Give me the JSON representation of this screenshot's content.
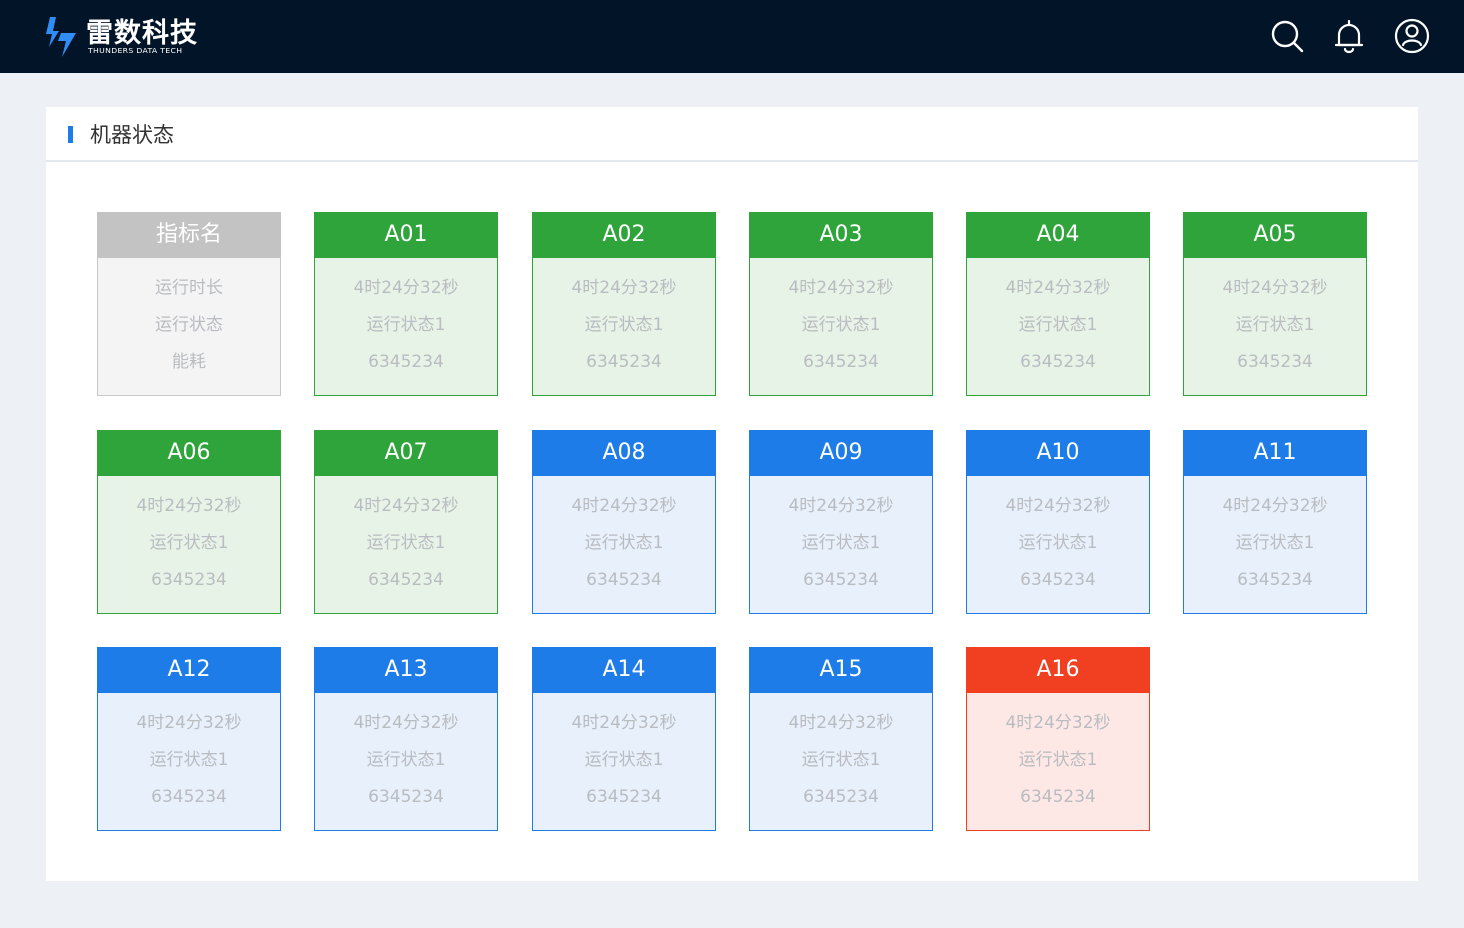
{
  "header": {
    "brand_cn": "雷数科技",
    "brand_en": "THUNDERS DATA TECH",
    "icons": [
      "search-icon",
      "bell-icon",
      "user-icon"
    ]
  },
  "panel": {
    "title": "机器状态"
  },
  "colors": {
    "accent": "#1e7ce8",
    "running": "#2ea43b",
    "standby": "#1e7ce8",
    "fault": "#f13f22",
    "legend": "#c3c3c3"
  },
  "legend_card": {
    "title": "指标名",
    "lines": [
      "运行时长",
      "运行状态",
      "能耗"
    ]
  },
  "machines": [
    {
      "id": "A01",
      "status": "green",
      "runtime": "4时24分32秒",
      "state": "运行状态1",
      "energy": "6345234"
    },
    {
      "id": "A02",
      "status": "green",
      "runtime": "4时24分32秒",
      "state": "运行状态1",
      "energy": "6345234"
    },
    {
      "id": "A03",
      "status": "green",
      "runtime": "4时24分32秒",
      "state": "运行状态1",
      "energy": "6345234"
    },
    {
      "id": "A04",
      "status": "green",
      "runtime": "4时24分32秒",
      "state": "运行状态1",
      "energy": "6345234"
    },
    {
      "id": "A05",
      "status": "green",
      "runtime": "4时24分32秒",
      "state": "运行状态1",
      "energy": "6345234"
    },
    {
      "id": "A06",
      "status": "green",
      "runtime": "4时24分32秒",
      "state": "运行状态1",
      "energy": "6345234"
    },
    {
      "id": "A07",
      "status": "green",
      "runtime": "4时24分32秒",
      "state": "运行状态1",
      "energy": "6345234"
    },
    {
      "id": "A08",
      "status": "blue",
      "runtime": "4时24分32秒",
      "state": "运行状态1",
      "energy": "6345234"
    },
    {
      "id": "A09",
      "status": "blue",
      "runtime": "4时24分32秒",
      "state": "运行状态1",
      "energy": "6345234"
    },
    {
      "id": "A10",
      "status": "blue",
      "runtime": "4时24分32秒",
      "state": "运行状态1",
      "energy": "6345234"
    },
    {
      "id": "A11",
      "status": "blue",
      "runtime": "4时24分32秒",
      "state": "运行状态1",
      "energy": "6345234"
    },
    {
      "id": "A12",
      "status": "blue",
      "runtime": "4时24分32秒",
      "state": "运行状态1",
      "energy": "6345234"
    },
    {
      "id": "A13",
      "status": "blue",
      "runtime": "4时24分32秒",
      "state": "运行状态1",
      "energy": "6345234"
    },
    {
      "id": "A14",
      "status": "blue",
      "runtime": "4时24分32秒",
      "state": "运行状态1",
      "energy": "6345234"
    },
    {
      "id": "A15",
      "status": "blue",
      "runtime": "4时24分32秒",
      "state": "运行状态1",
      "energy": "6345234"
    },
    {
      "id": "A16",
      "status": "red",
      "runtime": "4时24分32秒",
      "state": "运行状态1",
      "energy": "6345234"
    }
  ]
}
